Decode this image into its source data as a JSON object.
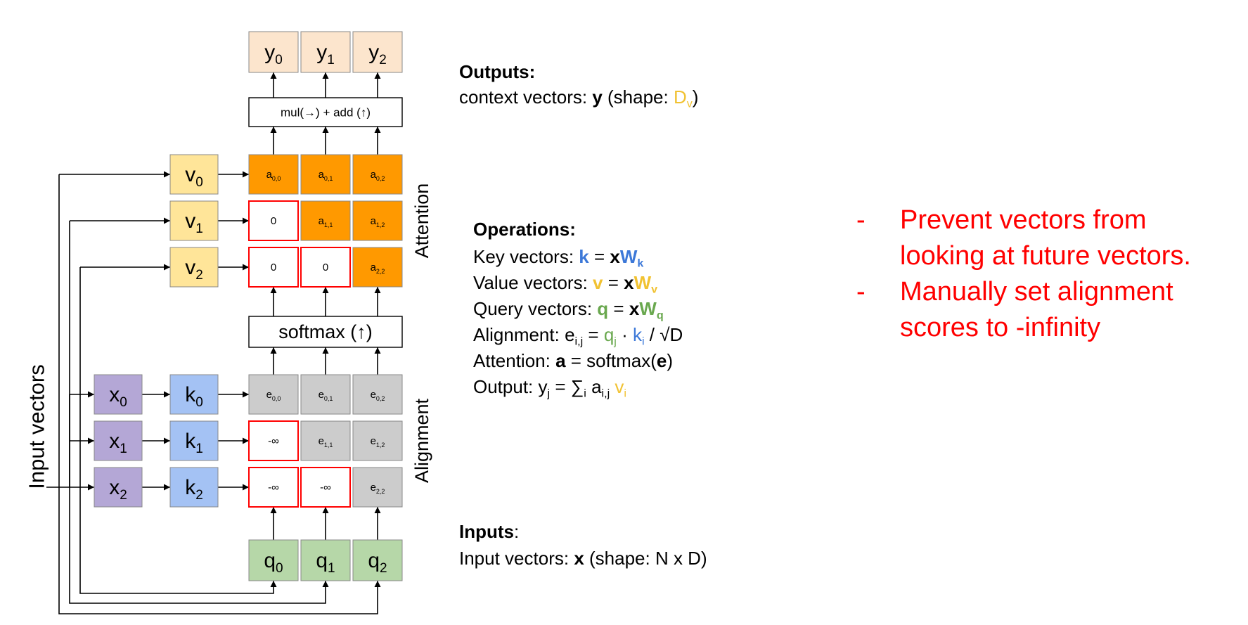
{
  "colors": {
    "output": "#fce5cd",
    "attention": "#ff9900",
    "alignment": "#cccccc",
    "value": "#ffe599",
    "key": "#a4c2f4",
    "query": "#b6d7a8",
    "input": "#b4a7d6",
    "masked_border": "#ff0000",
    "k_blue": "#3c78d8",
    "v_yellow": "#f1c232",
    "q_green": "#6aa84f",
    "note_red": "#ff0000"
  },
  "diagram": {
    "outputs": [
      "y",
      "y",
      "y"
    ],
    "output_subs": [
      "0",
      "1",
      "2"
    ],
    "mul_add_label": "mul(→) + add (↑)",
    "softmax_label": "softmax (↑)",
    "values": [
      "v",
      "v",
      "v"
    ],
    "value_subs": [
      "0",
      "1",
      "2"
    ],
    "keys": [
      "k",
      "k",
      "k"
    ],
    "key_subs": [
      "0",
      "1",
      "2"
    ],
    "inputs": [
      "x",
      "x",
      "x"
    ],
    "input_subs": [
      "0",
      "1",
      "2"
    ],
    "queries": [
      "q",
      "q",
      "q"
    ],
    "query_subs": [
      "0",
      "1",
      "2"
    ],
    "attention_rows": [
      [
        {
          "masked": false,
          "base": "a",
          "sub": "0,0"
        },
        {
          "masked": false,
          "base": "a",
          "sub": "0,1"
        },
        {
          "masked": false,
          "base": "a",
          "sub": "0,2"
        }
      ],
      [
        {
          "masked": true,
          "base": "0",
          "sub": ""
        },
        {
          "masked": false,
          "base": "a",
          "sub": "1,1"
        },
        {
          "masked": false,
          "base": "a",
          "sub": "1,2"
        }
      ],
      [
        {
          "masked": true,
          "base": "0",
          "sub": ""
        },
        {
          "masked": true,
          "base": "0",
          "sub": ""
        },
        {
          "masked": false,
          "base": "a",
          "sub": "2,2"
        }
      ]
    ],
    "alignment_rows": [
      [
        {
          "masked": false,
          "base": "e",
          "sub": "0,0"
        },
        {
          "masked": false,
          "base": "e",
          "sub": "0,1"
        },
        {
          "masked": false,
          "base": "e",
          "sub": "0,2"
        }
      ],
      [
        {
          "masked": true,
          "base": "-∞",
          "sub": ""
        },
        {
          "masked": false,
          "base": "e",
          "sub": "1,1"
        },
        {
          "masked": false,
          "base": "e",
          "sub": "1,2"
        }
      ],
      [
        {
          "masked": true,
          "base": "-∞",
          "sub": ""
        },
        {
          "masked": true,
          "base": "-∞",
          "sub": ""
        },
        {
          "masked": false,
          "base": "e",
          "sub": "2,2"
        }
      ]
    ],
    "attention_label": "Attention",
    "alignment_label": "Alignment",
    "input_vectors_label": "Input vectors"
  },
  "text": {
    "outputs_heading": "Outputs:",
    "outputs_line": {
      "pre": "context vectors: ",
      "bold": "y",
      "post": " (shape: ",
      "D": "D",
      "D_sub": "v",
      "close": ")"
    },
    "operations_heading": "Operations:",
    "key_line": {
      "pre": "Key vectors: ",
      "k": "k",
      "eq": " = ",
      "x": "x",
      "W": "W",
      "W_sub": "k"
    },
    "value_line": {
      "pre": "Value vectors: ",
      "v": "v",
      "eq": " = ",
      "x": "x",
      "W": "W",
      "W_sub": "v"
    },
    "query_line": {
      "pre": "Query vectors: ",
      "q": "q",
      "eq": " = ",
      "x": "x",
      "W": "W",
      "W_sub": "q"
    },
    "alignment_line": {
      "pre": "Alignment: e",
      "e_sub": "i,j",
      "eq": " = ",
      "q": "q",
      "q_sub": "j",
      "dot": " · ",
      "k": "k",
      "k_sub": "i",
      "post": " / √D"
    },
    "attention_line": {
      "pre": "Attention: ",
      "a": "a",
      "mid": " = softmax(",
      "e": "e",
      "close": ")"
    },
    "output_line": {
      "pre": "Output: y",
      "y_sub": "j",
      "sum": " = ∑",
      "sum_sub": "i",
      "a": " a",
      "a_sub": "i,j",
      "v": " v",
      "v_sub": "i"
    },
    "inputs_heading": "Inputs",
    "inputs_colon": ":",
    "inputs_line": {
      "pre": "Input vectors: ",
      "bold": "x",
      "post": " (shape: N x D)"
    }
  },
  "notes": {
    "dash": "-",
    "note1_line1": "Prevent vectors from",
    "note1_line2": "looking at future vectors.",
    "note2_line1": "Manually set alignment",
    "note2_line2": "scores to -infinity"
  }
}
